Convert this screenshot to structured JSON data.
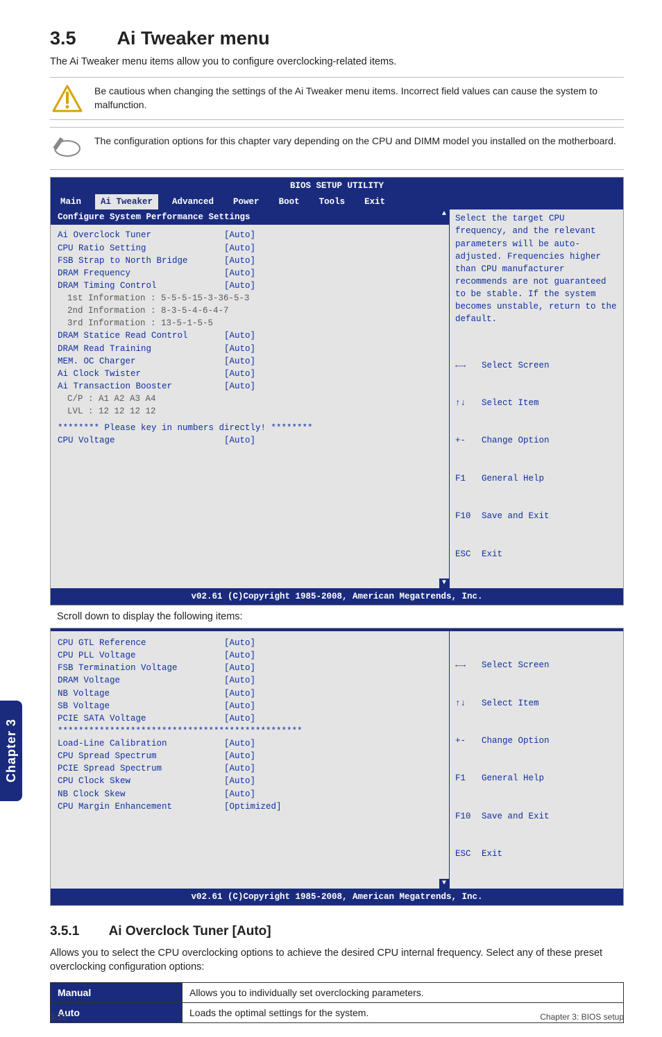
{
  "section": {
    "num": "3.5",
    "title": "Ai Tweaker menu"
  },
  "lead": "The Ai Tweaker menu items allow you to configure overclocking-related items.",
  "callouts": {
    "warn": "Be cautious when changing the settings of the Ai Tweaker menu items. Incorrect field values can cause the system to malfunction.",
    "note": "The configuration options for this chapter vary depending on the CPU and DIMM model you installed on the motherboard."
  },
  "bios1": {
    "title": "BIOS SETUP UTILITY",
    "menus": [
      "Main",
      "Ai Tweaker",
      "Advanced",
      "Power",
      "Boot",
      "Tools",
      "Exit"
    ],
    "active_menu": "Ai Tweaker",
    "panel_header": "Configure System Performance Settings",
    "rows": [
      {
        "label": "Ai Overclock Tuner",
        "val": "[Auto]"
      },
      {
        "label": "CPU Ratio Setting",
        "val": "[Auto]"
      },
      {
        "label": "FSB Strap to North Bridge",
        "val": "[Auto]"
      },
      {
        "label": "DRAM Frequency",
        "val": "[Auto]"
      },
      {
        "label": "DRAM Timing Control",
        "val": "[Auto]"
      }
    ],
    "subs": [
      "1st Information : 5-5-5-15-3-36-5-3",
      "2nd Information : 8-3-5-4-6-4-7",
      "3rd Information : 13-5-1-5-5"
    ],
    "rows2": [
      {
        "label": "DRAM Statice Read Control",
        "val": "[Auto]"
      },
      {
        "label": "DRAM Read Training",
        "val": "[Auto]"
      },
      {
        "label": "MEM. OC Charger",
        "val": "[Auto]"
      },
      {
        "label": "Ai Clock Twister",
        "val": "[Auto]"
      },
      {
        "label": "Ai Transaction Booster",
        "val": "[Auto]"
      }
    ],
    "subs2": [
      "C/P : A1 A2 A3 A4",
      "LVL : 12 12 12 12"
    ],
    "starline": "******** Please key in numbers directly! ********",
    "lastrow": {
      "label": "CPU Voltage",
      "val": "[Auto]"
    },
    "right_help": "Select the target CPU frequency, and the relevant parameters will be auto-adjusted. Frequencies higher than CPU manufacturer recommends are not guaranteed to be stable. If the system becomes unstable, return to the default.",
    "keys": [
      {
        "k": "←→",
        "t": "Select Screen"
      },
      {
        "k": "↑↓",
        "t": "Select Item"
      },
      {
        "k": "+-",
        "t": "Change Option"
      },
      {
        "k": "F1",
        "t": "General Help"
      },
      {
        "k": "F10",
        "t": "Save and Exit"
      },
      {
        "k": "ESC",
        "t": "Exit"
      }
    ],
    "footer": "v02.61 (C)Copyright 1985-2008, American Megatrends, Inc."
  },
  "between": "Scroll down to display the following items:",
  "bios2": {
    "rows": [
      {
        "label": "CPU GTL Reference",
        "val": "[Auto]"
      },
      {
        "label": "CPU PLL Voltage",
        "val": "[Auto]"
      },
      {
        "label": "FSB Termination Voltage",
        "val": "[Auto]"
      },
      {
        "label": "DRAM Voltage",
        "val": "[Auto]"
      },
      {
        "label": "NB Voltage",
        "val": "[Auto]"
      },
      {
        "label": "SB Voltage",
        "val": "[Auto]"
      },
      {
        "label": "PCIE SATA Voltage",
        "val": "[Auto]"
      }
    ],
    "stars": "***********************************************",
    "rows2": [
      {
        "label": "Load-Line Calibration",
        "val": "[Auto]"
      },
      {
        "label": "CPU Spread Spectrum",
        "val": "[Auto]"
      },
      {
        "label": "PCIE Spread Spectrum",
        "val": "[Auto]"
      },
      {
        "label": "CPU Clock Skew",
        "val": "[Auto]"
      },
      {
        "label": "NB Clock Skew",
        "val": "[Auto]"
      },
      {
        "label": "CPU Margin Enhancement",
        "val": "[Optimized]"
      }
    ],
    "keys": [
      {
        "k": "←→",
        "t": "Select Screen"
      },
      {
        "k": "↑↓",
        "t": "Select Item"
      },
      {
        "k": "+-",
        "t": "Change Option"
      },
      {
        "k": "F1",
        "t": "General Help"
      },
      {
        "k": "F10",
        "t": "Save and Exit"
      },
      {
        "k": "ESC",
        "t": "Exit"
      }
    ],
    "footer": "v02.61 (C)Copyright 1985-2008, American Megatrends, Inc."
  },
  "subsection": {
    "num": "3.5.1",
    "title": "Ai Overclock Tuner [Auto]"
  },
  "sub_body": "Allows you to select the CPU overclocking options to achieve the desired CPU internal frequency. Select any of these preset overclocking configuration options:",
  "opt_table": [
    {
      "key": "Manual",
      "desc": "Allows you to individually set overclocking parameters."
    },
    {
      "key": "Auto",
      "desc": "Loads the optimal settings for the system."
    }
  ],
  "side_tab": "Chapter 3",
  "footer_left": "3-12",
  "footer_right": "Chapter 3: BIOS setup"
}
